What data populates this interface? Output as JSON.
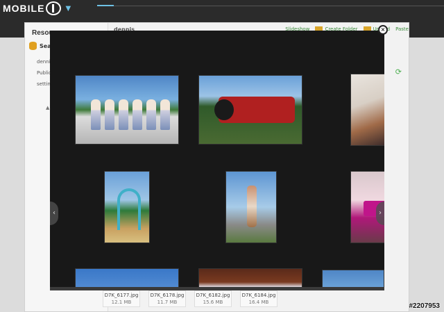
{
  "brand": {
    "logo_text": "MOBILE01",
    "logo_letters": "MOBILE"
  },
  "sidebar": {
    "title": "Resources",
    "search_label": "Sea",
    "items": [
      {
        "label": "denni"
      },
      {
        "label": "Public"
      },
      {
        "label": "setting"
      }
    ]
  },
  "main": {
    "breadcrumb": "dennis",
    "toolbar": [
      {
        "label": "Slideshow"
      },
      {
        "label": "Create Folder"
      },
      {
        "label": "Upload"
      },
      {
        "label": "Paste"
      }
    ]
  },
  "files": [
    {
      "name": "D7K_6177.jpg",
      "size": "12.1 MB"
    },
    {
      "name": "D7K_6178.jpg",
      "size": "11.7 MB"
    },
    {
      "name": "D7K_6182.jpg",
      "size": "15.6 MB"
    },
    {
      "name": "D7K_6184.jpg",
      "size": "16.4 MB"
    }
  ],
  "lightbox": {
    "close_symbol": "×",
    "prev_symbol": "‹",
    "next_symbol": "›"
  },
  "watermark": "#2207953",
  "colors": {
    "header_bg": "#2b2b2b",
    "accent_blue": "#6ec1e4",
    "toolbar_green": "#3a8a3a",
    "lightbox_bg": "#181818"
  }
}
